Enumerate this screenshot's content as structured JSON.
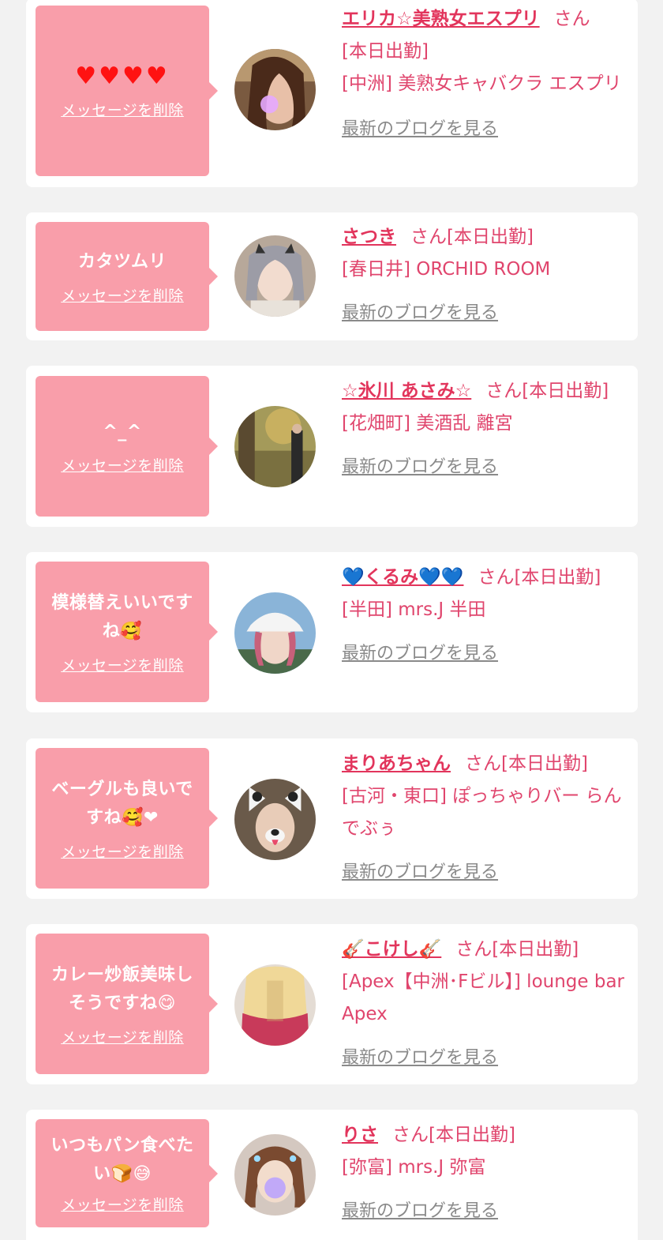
{
  "favorites": [
    {
      "message": "♥♥♥♥",
      "delete_label": "メッセージを削除",
      "name": "エリカ☆美熟女エスプリ",
      "suffix": "さん",
      "status": "[本日出勤]",
      "shop": "[中洲] 美熟女キャバクラ エスプリ",
      "blog_label": "最新のブログを見る"
    },
    {
      "message": "カタツムリ",
      "delete_label": "メッセージを削除",
      "name": "さつき",
      "suffix": "さん",
      "status": "[本日出勤]",
      "shop": "[春日井] ORCHID ROOM",
      "blog_label": "最新のブログを見る"
    },
    {
      "message": "^_^",
      "delete_label": "メッセージを削除",
      "name": "☆氷川 あさみ☆",
      "suffix": "さん",
      "status": "[本日出勤]",
      "shop": "[花畑町] 美酒乱 離宮",
      "blog_label": "最新のブログを見る"
    },
    {
      "message": "模様替えいいですね🥰",
      "delete_label": "メッセージを削除",
      "name": "💙くるみ💙💙",
      "suffix": "さん",
      "status": "[本日出勤]",
      "shop": "[半田] mrs.J 半田",
      "blog_label": "最新のブログを見る"
    },
    {
      "message": "ベーグルも良いですね🥰❤",
      "delete_label": "メッセージを削除",
      "name": "まりあちゃん",
      "suffix": "さん",
      "status": "[本日出勤]",
      "shop": "[古河・東口] ぽっちゃりバー らんでぶぅ",
      "blog_label": "最新のブログを見る"
    },
    {
      "message": "カレー炒飯美味しそうですね😋",
      "delete_label": "メッセージを削除",
      "name": "🎸こけし🎸",
      "suffix": "さん",
      "status": "[本日出勤]",
      "shop": "[Apex【中洲･Fビル】] lounge bar Apex",
      "blog_label": "最新のブログを見る"
    },
    {
      "message": "いつもパン食べたい🍞😅",
      "delete_label": "メッセージを削除",
      "name": "りさ",
      "suffix": "さん",
      "status": "[本日出勤]",
      "shop": "[弥富] mrs.J 弥富",
      "blog_label": "最新のブログを見る"
    }
  ],
  "colors": {
    "page_bg": "#f2f2f2",
    "card_bg": "#ffffff",
    "bubble_bg": "#f99eaa",
    "name_pink": "#e2355c",
    "text_pink": "#e0456d",
    "link_gray": "#8a8a8a"
  }
}
